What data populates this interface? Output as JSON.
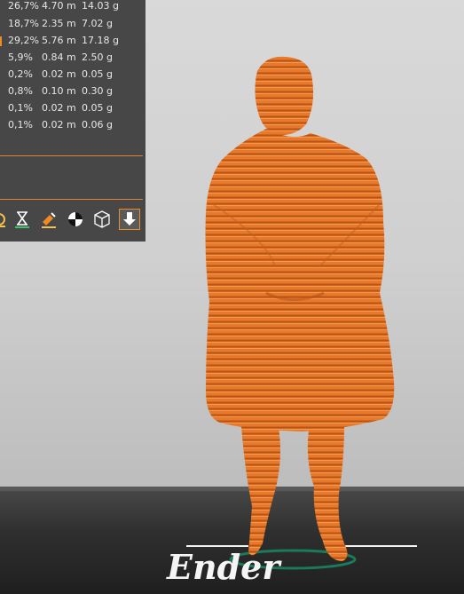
{
  "stats": {
    "rows": [
      {
        "percent": "26,7%",
        "length": "4.70 m",
        "weight": "14.03 g"
      },
      {
        "percent": "18,7%",
        "length": "2.35 m",
        "weight": "7.02 g"
      },
      {
        "percent": "29,2%",
        "length": "5.76 m",
        "weight": "17.18 g"
      },
      {
        "percent": "5,9%",
        "length": "0.84 m",
        "weight": "2.50 g"
      },
      {
        "percent": "0,2%",
        "length": "0.02 m",
        "weight": "0.05 g"
      },
      {
        "percent": "0,8%",
        "length": "0.10 m",
        "weight": "0.30 g"
      },
      {
        "percent": "0,1%",
        "length": "0.02 m",
        "weight": "0.05 g"
      },
      {
        "percent": "0,1%",
        "length": "0.02 m",
        "weight": "0.06 g"
      }
    ]
  },
  "toolbar": {
    "icons": [
      "layers-icon",
      "hourglass-icon",
      "paint-brush-icon",
      "pie-chart-icon",
      "wireframe-cube-icon",
      "export-download-icon"
    ]
  },
  "colors": {
    "panel_bg": "#474747",
    "accent": "#f08a24",
    "model": "#e8782a",
    "bed": "#2f2f2f",
    "logo_green": "#1b7a5a"
  },
  "bed_logo": "Ender"
}
